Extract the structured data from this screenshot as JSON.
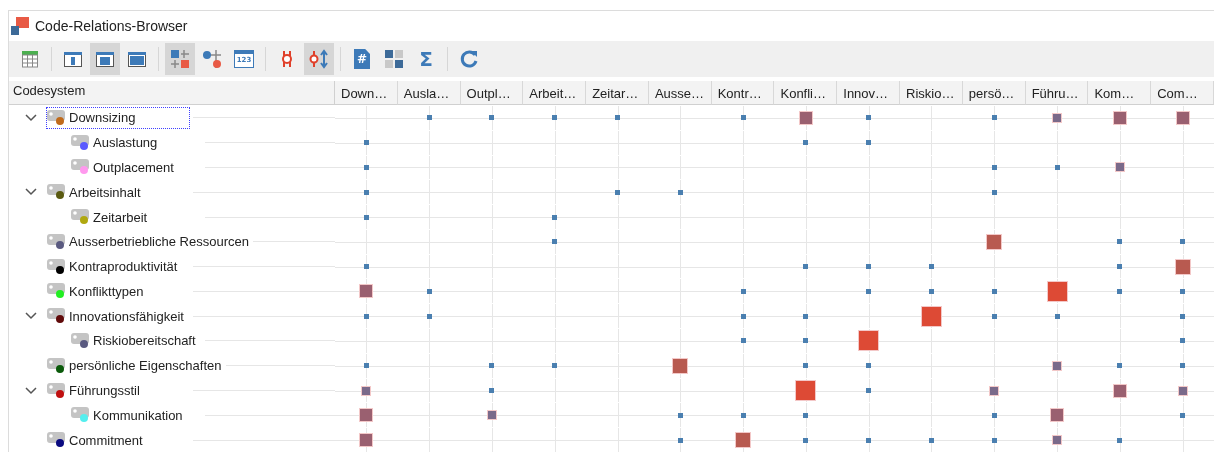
{
  "window": {
    "title": "Code-Relations-Browser"
  },
  "toolbar": [
    [
      {
        "kind": "table",
        "pressed": false
      }
    ],
    [
      {
        "kind": "layout-left",
        "pressed": false
      },
      {
        "kind": "layout-center",
        "pressed": true
      },
      {
        "kind": "layout-full",
        "pressed": false
      }
    ],
    [
      {
        "kind": "matrix",
        "pressed": true
      },
      {
        "kind": "nodes",
        "pressed": false
      },
      {
        "kind": "numbers",
        "pressed": false,
        "glyph": "123"
      }
    ],
    [
      {
        "kind": "split",
        "pressed": false
      },
      {
        "kind": "split-arrows",
        "pressed": true
      }
    ],
    [
      {
        "kind": "hash-doc",
        "pressed": false,
        "glyph": "#"
      },
      {
        "kind": "binary",
        "pressed": false
      },
      {
        "kind": "sum",
        "pressed": false,
        "glyph": "Σ"
      }
    ],
    [
      {
        "kind": "refresh",
        "pressed": false
      }
    ]
  ],
  "table": {
    "tree_header": "Codesystem",
    "columns": [
      "Down…",
      "Ausla…",
      "Outpl…",
      "Arbeit…",
      "Zeitar…",
      "Ausse…",
      "Kontr…",
      "Konfli…",
      "Innov…",
      "Riskio…",
      "persö…",
      "Führu…",
      "Kom…",
      "Com…"
    ],
    "codes": [
      {
        "label": "Downsizing",
        "color": "#c06a1a",
        "selected": true,
        "expanded": true,
        "cells": [
          {
            "kind": "none"
          },
          {
            "kind": "dot"
          },
          {
            "kind": "dot"
          },
          {
            "kind": "dot"
          },
          {
            "kind": "dot"
          },
          {
            "kind": "none"
          },
          {
            "kind": "dot"
          },
          {
            "kind": "medium"
          },
          {
            "kind": "dot"
          },
          {
            "kind": "none"
          },
          {
            "kind": "dot"
          },
          {
            "kind": "small"
          },
          {
            "kind": "medium"
          },
          {
            "kind": "medium"
          }
        ],
        "children": [
          {
            "label": "Auslastung",
            "color": "#5a5aff",
            "selected": false,
            "cells": [
              {
                "kind": "dot"
              },
              {
                "kind": "none"
              },
              {
                "kind": "none"
              },
              {
                "kind": "none"
              },
              {
                "kind": "none"
              },
              {
                "kind": "none"
              },
              {
                "kind": "none"
              },
              {
                "kind": "dot"
              },
              {
                "kind": "dot"
              },
              {
                "kind": "none"
              },
              {
                "kind": "none"
              },
              {
                "kind": "none"
              },
              {
                "kind": "none"
              },
              {
                "kind": "none"
              }
            ]
          },
          {
            "label": "Outplacement",
            "color": "#ff99ee",
            "selected": false,
            "cells": [
              {
                "kind": "dot"
              },
              {
                "kind": "none"
              },
              {
                "kind": "none"
              },
              {
                "kind": "none"
              },
              {
                "kind": "none"
              },
              {
                "kind": "none"
              },
              {
                "kind": "none"
              },
              {
                "kind": "none"
              },
              {
                "kind": "none"
              },
              {
                "kind": "none"
              },
              {
                "kind": "dot"
              },
              {
                "kind": "dot"
              },
              {
                "kind": "small"
              },
              {
                "kind": "none"
              }
            ]
          }
        ]
      },
      {
        "label": "Arbeitsinhalt",
        "color": "#5a5a10",
        "selected": false,
        "expanded": true,
        "cells": [
          {
            "kind": "dot"
          },
          {
            "kind": "none"
          },
          {
            "kind": "none"
          },
          {
            "kind": "none"
          },
          {
            "kind": "dot"
          },
          {
            "kind": "dot"
          },
          {
            "kind": "none"
          },
          {
            "kind": "none"
          },
          {
            "kind": "none"
          },
          {
            "kind": "none"
          },
          {
            "kind": "dot"
          },
          {
            "kind": "none"
          },
          {
            "kind": "none"
          },
          {
            "kind": "none"
          }
        ],
        "children": [
          {
            "label": "Zeitarbeit",
            "color": "#b0a810",
            "selected": false,
            "cells": [
              {
                "kind": "dot"
              },
              {
                "kind": "none"
              },
              {
                "kind": "none"
              },
              {
                "kind": "dot"
              },
              {
                "kind": "none"
              },
              {
                "kind": "none"
              },
              {
                "kind": "none"
              },
              {
                "kind": "none"
              },
              {
                "kind": "none"
              },
              {
                "kind": "none"
              },
              {
                "kind": "none"
              },
              {
                "kind": "none"
              },
              {
                "kind": "none"
              },
              {
                "kind": "none"
              }
            ]
          }
        ]
      },
      {
        "label": "Ausserbetriebliche Ressourcen",
        "color": "#5a5a80",
        "selected": false,
        "cells": [
          {
            "kind": "none"
          },
          {
            "kind": "none"
          },
          {
            "kind": "none"
          },
          {
            "kind": "dot"
          },
          {
            "kind": "none"
          },
          {
            "kind": "none"
          },
          {
            "kind": "none"
          },
          {
            "kind": "none"
          },
          {
            "kind": "none"
          },
          {
            "kind": "none"
          },
          {
            "kind": "large"
          },
          {
            "kind": "none"
          },
          {
            "kind": "dot"
          },
          {
            "kind": "dot"
          }
        ]
      },
      {
        "label": "Kontraproduktivität",
        "color": "#000000",
        "selected": false,
        "cells": [
          {
            "kind": "dot"
          },
          {
            "kind": "none"
          },
          {
            "kind": "none"
          },
          {
            "kind": "none"
          },
          {
            "kind": "none"
          },
          {
            "kind": "none"
          },
          {
            "kind": "none"
          },
          {
            "kind": "dot"
          },
          {
            "kind": "dot"
          },
          {
            "kind": "dot"
          },
          {
            "kind": "none"
          },
          {
            "kind": "none"
          },
          {
            "kind": "dot"
          },
          {
            "kind": "large"
          }
        ]
      },
      {
        "label": "Konflikttypen",
        "color": "#22ee22",
        "selected": false,
        "cells": [
          {
            "kind": "medium"
          },
          {
            "kind": "dot"
          },
          {
            "kind": "none"
          },
          {
            "kind": "none"
          },
          {
            "kind": "none"
          },
          {
            "kind": "none"
          },
          {
            "kind": "dot"
          },
          {
            "kind": "none"
          },
          {
            "kind": "dot"
          },
          {
            "kind": "dot"
          },
          {
            "kind": "dot"
          },
          {
            "kind": "xlarge"
          },
          {
            "kind": "dot"
          },
          {
            "kind": "dot"
          }
        ]
      },
      {
        "label": "Innovationsfähigkeit",
        "color": "#600a0a",
        "selected": false,
        "expanded": true,
        "cells": [
          {
            "kind": "dot"
          },
          {
            "kind": "dot"
          },
          {
            "kind": "none"
          },
          {
            "kind": "none"
          },
          {
            "kind": "none"
          },
          {
            "kind": "none"
          },
          {
            "kind": "dot"
          },
          {
            "kind": "dot"
          },
          {
            "kind": "none"
          },
          {
            "kind": "xlarge"
          },
          {
            "kind": "dot"
          },
          {
            "kind": "dot"
          },
          {
            "kind": "none"
          },
          {
            "kind": "dot"
          }
        ],
        "children": [
          {
            "label": "Riskiobereitschaft",
            "color": "#5a5a80",
            "selected": false,
            "cells": [
              {
                "kind": "none"
              },
              {
                "kind": "none"
              },
              {
                "kind": "none"
              },
              {
                "kind": "none"
              },
              {
                "kind": "none"
              },
              {
                "kind": "none"
              },
              {
                "kind": "dot"
              },
              {
                "kind": "dot"
              },
              {
                "kind": "xlarge"
              },
              {
                "kind": "none"
              },
              {
                "kind": "none"
              },
              {
                "kind": "none"
              },
              {
                "kind": "none"
              },
              {
                "kind": "dot"
              }
            ]
          }
        ]
      },
      {
        "label": "persönliche Eigenschaften",
        "color": "#0a5a0a",
        "selected": false,
        "cells": [
          {
            "kind": "dot"
          },
          {
            "kind": "none"
          },
          {
            "kind": "dot"
          },
          {
            "kind": "dot"
          },
          {
            "kind": "none"
          },
          {
            "kind": "large"
          },
          {
            "kind": "none"
          },
          {
            "kind": "dot"
          },
          {
            "kind": "dot"
          },
          {
            "kind": "none"
          },
          {
            "kind": "none"
          },
          {
            "kind": "small"
          },
          {
            "kind": "dot"
          },
          {
            "kind": "dot"
          }
        ]
      },
      {
        "label": "Führungsstil",
        "color": "#c01010",
        "selected": false,
        "expanded": true,
        "cells": [
          {
            "kind": "small"
          },
          {
            "kind": "none"
          },
          {
            "kind": "dot"
          },
          {
            "kind": "none"
          },
          {
            "kind": "none"
          },
          {
            "kind": "none"
          },
          {
            "kind": "none"
          },
          {
            "kind": "xlarge"
          },
          {
            "kind": "dot"
          },
          {
            "kind": "none"
          },
          {
            "kind": "small"
          },
          {
            "kind": "none"
          },
          {
            "kind": "medium"
          },
          {
            "kind": "small"
          }
        ],
        "children": [
          {
            "label": "Kommunikation",
            "color": "#55eeee",
            "selected": false,
            "cells": [
              {
                "kind": "medium"
              },
              {
                "kind": "none"
              },
              {
                "kind": "small"
              },
              {
                "kind": "none"
              },
              {
                "kind": "none"
              },
              {
                "kind": "dot"
              },
              {
                "kind": "dot"
              },
              {
                "kind": "dot"
              },
              {
                "kind": "none"
              },
              {
                "kind": "none"
              },
              {
                "kind": "dot"
              },
              {
                "kind": "medium"
              },
              {
                "kind": "none"
              },
              {
                "kind": "dot"
              }
            ]
          }
        ]
      },
      {
        "label": "Commitment",
        "color": "#0a0a80",
        "selected": false,
        "cells": [
          {
            "kind": "medium"
          },
          {
            "kind": "none"
          },
          {
            "kind": "none"
          },
          {
            "kind": "none"
          },
          {
            "kind": "none"
          },
          {
            "kind": "dot"
          },
          {
            "kind": "large"
          },
          {
            "kind": "dot"
          },
          {
            "kind": "dot"
          },
          {
            "kind": "dot"
          },
          {
            "kind": "dot"
          },
          {
            "kind": "small"
          },
          {
            "kind": "dot"
          },
          {
            "kind": "none"
          }
        ]
      }
    ]
  }
}
